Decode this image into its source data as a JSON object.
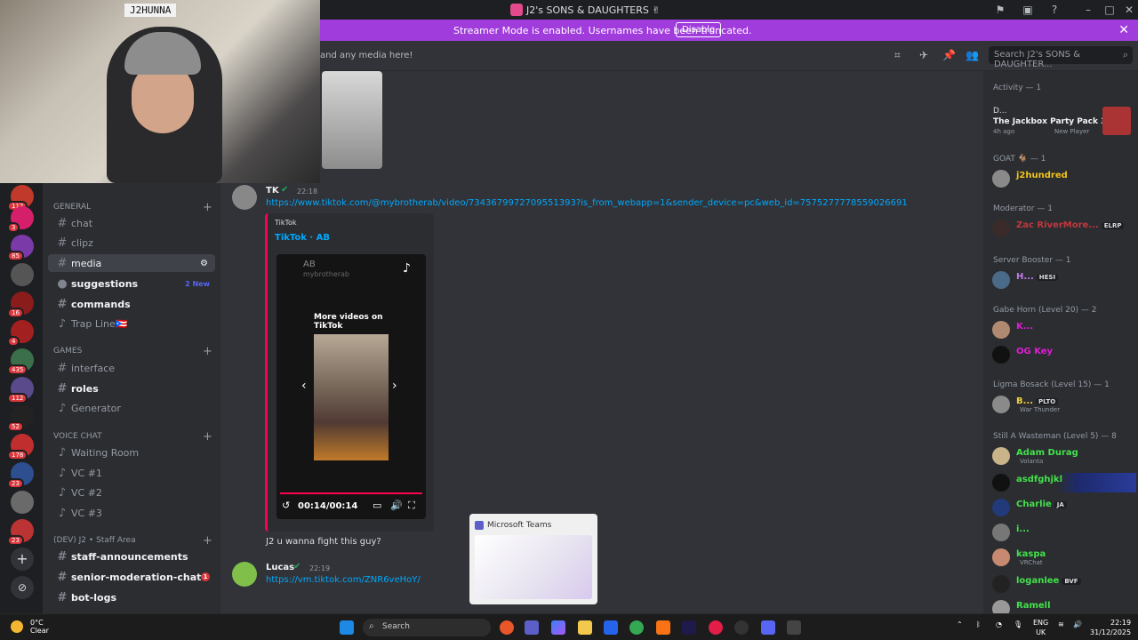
{
  "window": {
    "title": "J2's SONS & DAUGHTERS ✌"
  },
  "banner": {
    "message": "Streamer Mode is enabled. Usernames have been truncated.",
    "disable_label": "Disable"
  },
  "webcam": {
    "name_tag": "J2HUNNA"
  },
  "header": {
    "topic": "and any media here!",
    "search_placeholder": "Search J2's SONS & DAUGHTER..."
  },
  "rail": {
    "badges": [
      "112",
      "3",
      "85",
      "16",
      "4",
      "435",
      "112",
      "52",
      "178",
      "23",
      "23"
    ]
  },
  "channels": {
    "categories": {
      "general": "GENERAL",
      "games": "GAMES",
      "voice": "VOICE CHAT",
      "staff": "(DEV) J2 • Staff Area"
    },
    "items": {
      "chat": "chat",
      "clipz": "clipz",
      "media": "media",
      "suggestions": "suggestions",
      "suggestions_new": "2 New",
      "commands": "commands",
      "trapline": "Trap Line🇵🇷",
      "interface": "interface",
      "roles": "roles",
      "generator": "Generator",
      "waiting": "Waiting Room",
      "vc1": "VC #1",
      "vc2": "VC #2",
      "vc3": "VC #3",
      "staff_ann": "staff-announcements",
      "senior_mod": "senior-moderation-chat",
      "senior_mod_count": "1",
      "botlogs": "bot-logs"
    }
  },
  "chat": {
    "msg1": {
      "user": "TK",
      "time": "22:18",
      "link": "https://www.tiktok.com/@mybrotherab/video/7343679972709551393?is_from_webapp=1&sender_device=pc&web_id=7575277778559026691",
      "embed_provider": "TikTok",
      "embed_title": "TikTok · AB",
      "video_handle": "AB",
      "video_subhandle": "mybrotherab",
      "video_more": "More videos on TikTok",
      "video_time": "00:14/00:14",
      "text": "J2 u wanna fight this guy?"
    },
    "msg2": {
      "user": "Lucas",
      "time": "22:19",
      "link": "https://vm.tiktok.com/ZNR6veHoY/"
    }
  },
  "teams_popup": {
    "label": "Microsoft Teams"
  },
  "members": {
    "activity": {
      "header": "Activity — 1",
      "user": "D...",
      "game": "The Jackbox Party Pack 3",
      "meta": "4h ago",
      "tag": "New Player"
    },
    "groups": [
      {
        "title": "GOAT 🐐 — 1",
        "members": [
          {
            "name": "j2hundred",
            "color": "#f0c419"
          }
        ]
      },
      {
        "title": "Moderator — 1",
        "members": [
          {
            "name": "Zac RiverMore...",
            "color": "#c2373d",
            "tag": "ELRP"
          }
        ]
      },
      {
        "title": "Server Booster — 1",
        "members": [
          {
            "name": "H...",
            "color": "#c27bf0",
            "tag": "HESI"
          }
        ]
      },
      {
        "title": "Gabe Horn (Level 20) — 2",
        "members": [
          {
            "name": "K...",
            "color": "#e01bd6"
          },
          {
            "name": "OG Key",
            "color": "#e01bd6"
          }
        ]
      },
      {
        "title": "Ligma Bosack (Level 15) — 1",
        "members": [
          {
            "name": "B...",
            "color": "#f0d13a",
            "tag": "PLTO",
            "sub": "War Thunder"
          }
        ]
      },
      {
        "title": "Still A Wasteman (Level 5) — 8",
        "members": [
          {
            "name": "Adam Durag",
            "color": "#43e14b",
            "sub": "Volanta"
          },
          {
            "name": "asdfghjkl",
            "color": "#43e14b"
          },
          {
            "name": "Charlie",
            "color": "#43e14b",
            "tag": "JA"
          },
          {
            "name": "i...",
            "color": "#43e14b"
          },
          {
            "name": "kaspa",
            "color": "#43e14b",
            "sub": "VRChat"
          },
          {
            "name": "loganlee",
            "color": "#43e14b",
            "tag": "BVF"
          },
          {
            "name": "Ramell",
            "color": "#43e14b"
          }
        ]
      }
    ]
  },
  "taskbar": {
    "temp": "0°C",
    "weather": "Clear",
    "search": "Search",
    "lang": "ENG",
    "region": "UK",
    "time": "22:19",
    "date": "31/12/2025"
  }
}
